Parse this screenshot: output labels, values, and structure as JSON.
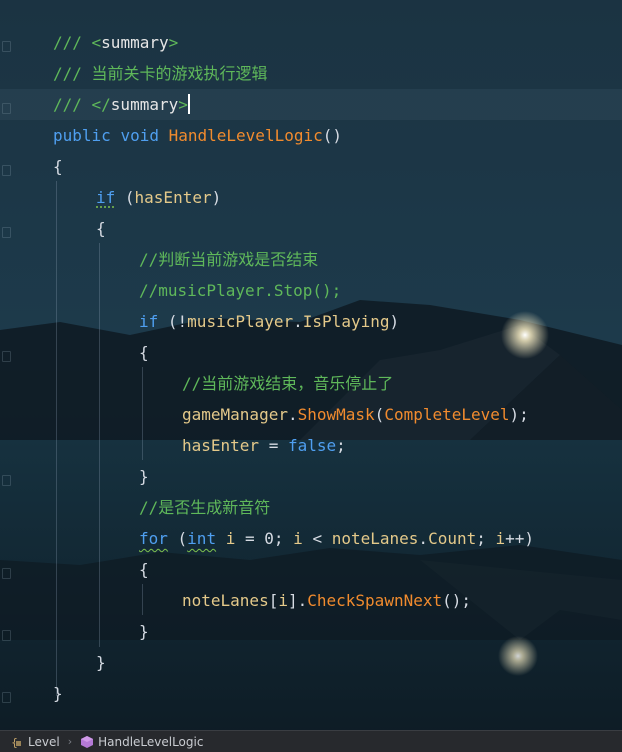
{
  "editor": {
    "lines": [
      [
        {
          "t": "/// ",
          "k": "c-comment"
        },
        {
          "t": "<summary>",
          "k": "c-doc-tag"
        }
      ],
      [
        {
          "t": "/// 当前关卡的游戏执行逻辑",
          "k": "c-comment"
        }
      ],
      [
        {
          "t": "/// ",
          "k": "c-comment"
        },
        {
          "t": "</summary>",
          "k": "c-doc-tag"
        }
      ],
      [
        {
          "t": "public",
          "k": "c-kw"
        },
        {
          "t": " ",
          "k": "c-plain"
        },
        {
          "t": "void",
          "k": "c-kw"
        },
        {
          "t": " ",
          "k": "c-plain"
        },
        {
          "t": "HandleLevelLogic",
          "k": "c-fn"
        },
        {
          "t": "()",
          "k": "c-plain"
        }
      ],
      [
        {
          "t": "{",
          "k": "c-plain"
        }
      ],
      [
        {
          "t": "if",
          "k": "c-kw squiggle"
        },
        {
          "t": " (",
          "k": "c-plain"
        },
        {
          "t": "hasEnter",
          "k": "c-ident"
        },
        {
          "t": ")",
          "k": "c-plain"
        }
      ],
      [
        {
          "t": "{",
          "k": "c-plain"
        }
      ],
      [
        {
          "t": "//判断当前游戏是否结束",
          "k": "c-comment"
        }
      ],
      [
        {
          "t": "//musicPlayer.Stop();",
          "k": "c-comment"
        }
      ],
      [
        {
          "t": "if",
          "k": "c-kw"
        },
        {
          "t": " (!",
          "k": "c-plain"
        },
        {
          "t": "musicPlayer",
          "k": "c-ident"
        },
        {
          "t": ".",
          "k": "c-plain"
        },
        {
          "t": "IsPlaying",
          "k": "c-ident"
        },
        {
          "t": ")",
          "k": "c-plain"
        }
      ],
      [
        {
          "t": "{",
          "k": "c-plain"
        }
      ],
      [
        {
          "t": "//当前游戏结束，音乐停止了",
          "k": "c-comment"
        }
      ],
      [
        {
          "t": "gameManager",
          "k": "c-ident"
        },
        {
          "t": ".",
          "k": "c-plain"
        },
        {
          "t": "ShowMask",
          "k": "c-fn"
        },
        {
          "t": "(",
          "k": "c-plain"
        },
        {
          "t": "CompleteLevel",
          "k": "c-fn"
        },
        {
          "t": ");",
          "k": "c-plain"
        }
      ],
      [
        {
          "t": "hasEnter",
          "k": "c-ident"
        },
        {
          "t": " = ",
          "k": "c-plain"
        },
        {
          "t": "false",
          "k": "c-kw"
        },
        {
          "t": ";",
          "k": "c-plain"
        }
      ],
      [
        {
          "t": "}",
          "k": "c-plain"
        }
      ],
      [
        {
          "t": "//是否生成新音符",
          "k": "c-comment"
        }
      ],
      [
        {
          "t": "for",
          "k": "c-kw squiggle2"
        },
        {
          "t": " (",
          "k": "c-plain"
        },
        {
          "t": "int",
          "k": "c-kw squiggle2"
        },
        {
          "t": " ",
          "k": "c-plain"
        },
        {
          "t": "i",
          "k": "c-ident"
        },
        {
          "t": " = ",
          "k": "c-plain"
        },
        {
          "t": "0",
          "k": "c-num"
        },
        {
          "t": "; ",
          "k": "c-plain"
        },
        {
          "t": "i",
          "k": "c-ident"
        },
        {
          "t": " < ",
          "k": "c-plain"
        },
        {
          "t": "noteLanes",
          "k": "c-ident"
        },
        {
          "t": ".",
          "k": "c-plain"
        },
        {
          "t": "Count",
          "k": "c-ident"
        },
        {
          "t": "; ",
          "k": "c-plain"
        },
        {
          "t": "i",
          "k": "c-ident"
        },
        {
          "t": "++)",
          "k": "c-plain"
        }
      ],
      [
        {
          "t": "{",
          "k": "c-plain"
        }
      ],
      [
        {
          "t": "noteLanes",
          "k": "c-ident"
        },
        {
          "t": "[",
          "k": "c-plain"
        },
        {
          "t": "i",
          "k": "c-ident"
        },
        {
          "t": "].",
          "k": "c-plain"
        },
        {
          "t": "CheckSpawnNext",
          "k": "c-fn"
        },
        {
          "t": "();",
          "k": "c-plain"
        }
      ],
      [
        {
          "t": "}",
          "k": "c-plain"
        }
      ],
      [
        {
          "t": "}",
          "k": "c-plain"
        }
      ],
      [
        {
          "t": "}",
          "k": "c-plain"
        }
      ]
    ]
  },
  "statusbar": {
    "file_label": "Level",
    "member_label": "HandleLevelLogic",
    "separator": "›"
  }
}
